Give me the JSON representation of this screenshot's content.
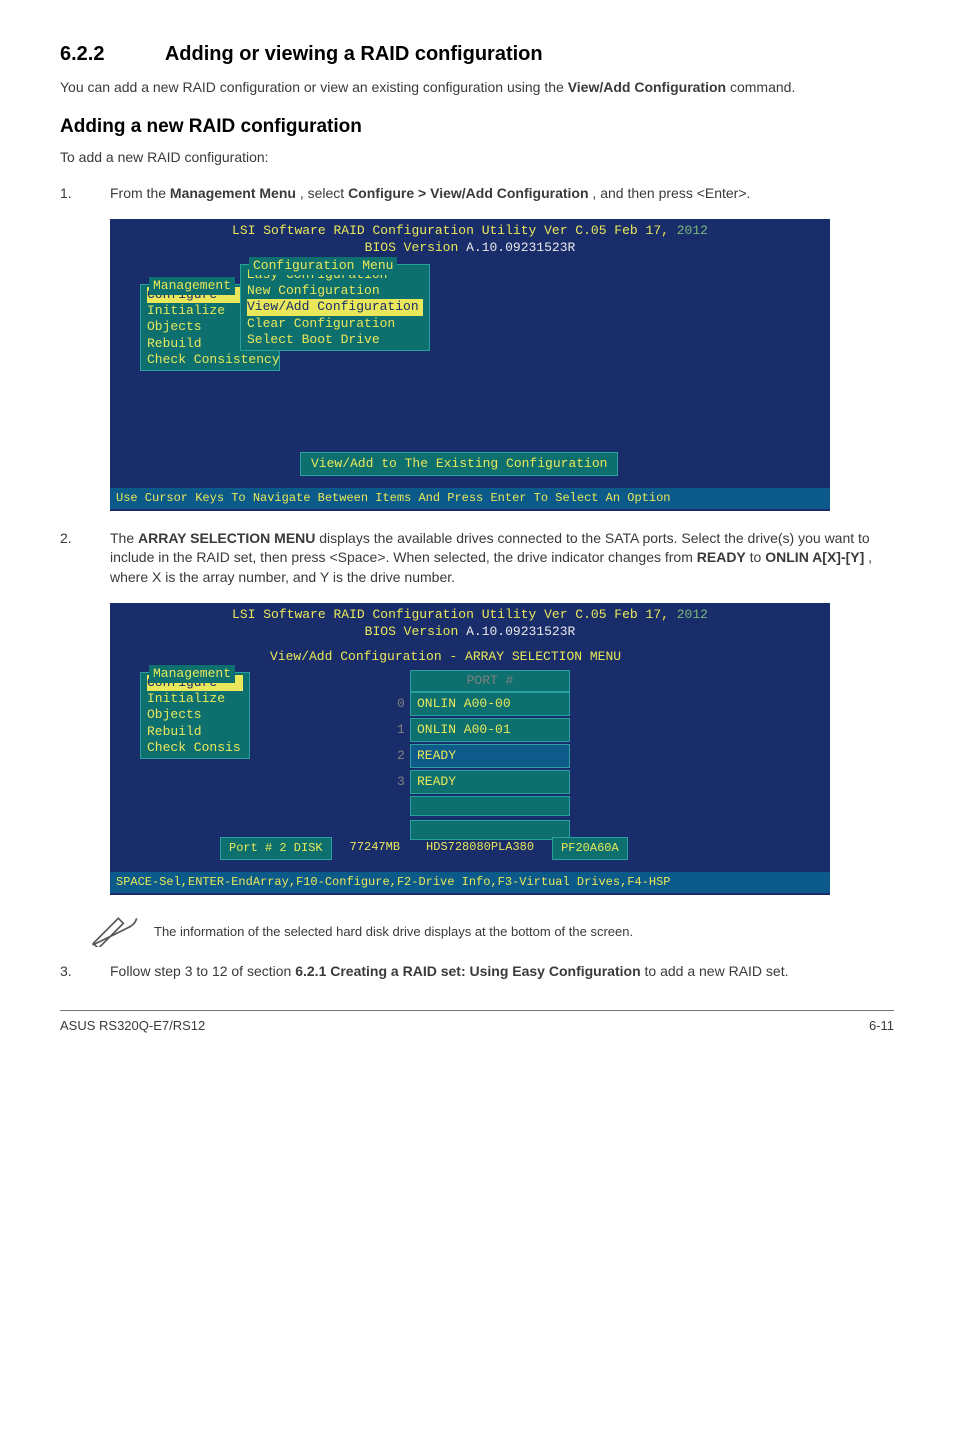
{
  "section": {
    "number": "6.2.2",
    "title": "Adding or viewing a RAID configuration",
    "intro_prefix": "You can add a new RAID configuration or view an existing configuration using the ",
    "intro_bold": "View/Add Configuration",
    "intro_suffix": " command."
  },
  "subhead": "Adding a new RAID configuration",
  "subhead_intro": "To add a new RAID configuration:",
  "steps": {
    "s1": {
      "num": "1.",
      "pre": "From the ",
      "b1": "Management Menu",
      "mid": ", select ",
      "b2": "Configure > View/Add Configuration",
      "post": ", and then press <Enter>."
    },
    "s2": {
      "num": "2.",
      "pre": "The ",
      "b1": "ARRAY SELECTION MENU",
      "mid1": " displays the available drives connected to the SATA ports. Select the drive(s) you want to include in the RAID set, then press <Space>. When selected, the drive indicator changes from ",
      "b2": "READY",
      "mid2": " to ",
      "b3": "ONLIN A[X]-[Y]",
      "post": ", where X is the array number, and Y is the drive number."
    },
    "s3": {
      "num": "3.",
      "pre": "Follow step 3 to 12 of section ",
      "b1": "6.2.1 Creating a RAID set: Using Easy Configuration",
      "post": " to add a new RAID set."
    }
  },
  "bios1": {
    "title_l1a": "LSI Software RAID Configuration Utility Ver C.05 Feb 17,",
    "title_l1b": " 2012",
    "title_l2a": "BIOS Version   ",
    "title_l2b": "A.10.09231523R",
    "mgmt_head": "Management",
    "mgmt_items": [
      "Configure",
      "Initialize",
      "Objects",
      "Rebuild",
      "Check Consistency"
    ],
    "cfg_head": "Configuration Menu",
    "cfg_items": [
      "Easy Configuration",
      "New Configuration",
      "View/Add Configuration",
      "Clear Configuration",
      "Select Boot Drive"
    ],
    "bottom_box": "View/Add to The Existing Configuration",
    "footer": "Use Cursor Keys To Navigate Between Items And Press Enter To Select An Option"
  },
  "bios2": {
    "title_l1a": "LSI Software RAID Configuration Utility Ver C.05 Feb 17,",
    "title_l1b": " 2012",
    "title_l2a": "BIOS Version   ",
    "title_l2b": "A.10.09231523R",
    "panel_title": "View/Add Configuration - ARRAY SELECTION MENU",
    "mgmt_head": "Management",
    "mgmt_items": [
      "Configure",
      "Initialize",
      "Objects",
      "Rebuild",
      "Check Consis"
    ],
    "col_head": "PORT #",
    "drives": [
      {
        "idx": "0",
        "label": "ONLIN A00-00"
      },
      {
        "idx": "1",
        "label": "ONLIN A00-01"
      },
      {
        "idx": "2",
        "label": "READY"
      },
      {
        "idx": "3",
        "label": "READY"
      }
    ],
    "info": [
      "Port # 2 DISK",
      "77247MB",
      "HDS728080PLA380",
      "PF20A60A"
    ],
    "footer": "SPACE-Sel,ENTER-EndArray,F10-Configure,F2-Drive Info,F3-Virtual Drives,F4-HSP"
  },
  "note_text": "The information of the selected hard disk drive displays at the bottom of the screen.",
  "page_footer": {
    "left": "ASUS RS320Q-E7/RS12",
    "right": "6-11"
  }
}
